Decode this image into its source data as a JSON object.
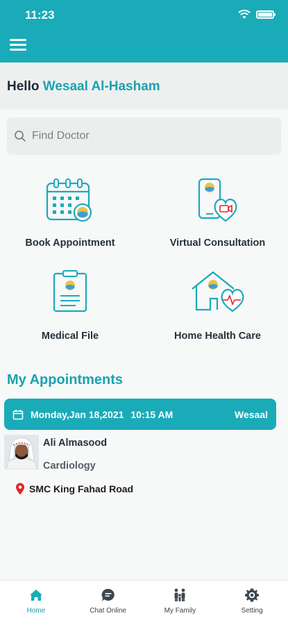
{
  "status_bar": {
    "time": "11:23"
  },
  "greeting": {
    "prefix": "Hello",
    "user_name": "Wesaal Al-Hasham"
  },
  "search": {
    "placeholder": "Find Doctor"
  },
  "services": [
    {
      "label": "Book Appointment",
      "icon": "calendar-icon"
    },
    {
      "label": "Virtual Consultation",
      "icon": "phone-heart-icon"
    },
    {
      "label": "Medical File",
      "icon": "clipboard-icon"
    },
    {
      "label": "Home Health Care",
      "icon": "house-heart-icon"
    }
  ],
  "appointments": {
    "title": "My Appointments",
    "items": [
      {
        "date": "Monday,Jan 18,2021",
        "time": "10:15 AM",
        "patient": "Wesaal",
        "doctor_name": "Ali Almasood",
        "specialty": "Cardiology",
        "location": "SMC King Fahad Road"
      }
    ]
  },
  "tabs": [
    {
      "label": "Home",
      "icon": "home-icon",
      "active": true
    },
    {
      "label": "Chat Online",
      "icon": "chat-icon",
      "active": false
    },
    {
      "label": "My Family",
      "icon": "family-icon",
      "active": false
    },
    {
      "label": "Setting",
      "icon": "gear-icon",
      "active": false
    }
  ],
  "colors": {
    "primary": "#1aabb8",
    "accent_text": "#1aa3b0",
    "location_pin": "#e2252b",
    "tab_inactive": "#3d4750"
  }
}
